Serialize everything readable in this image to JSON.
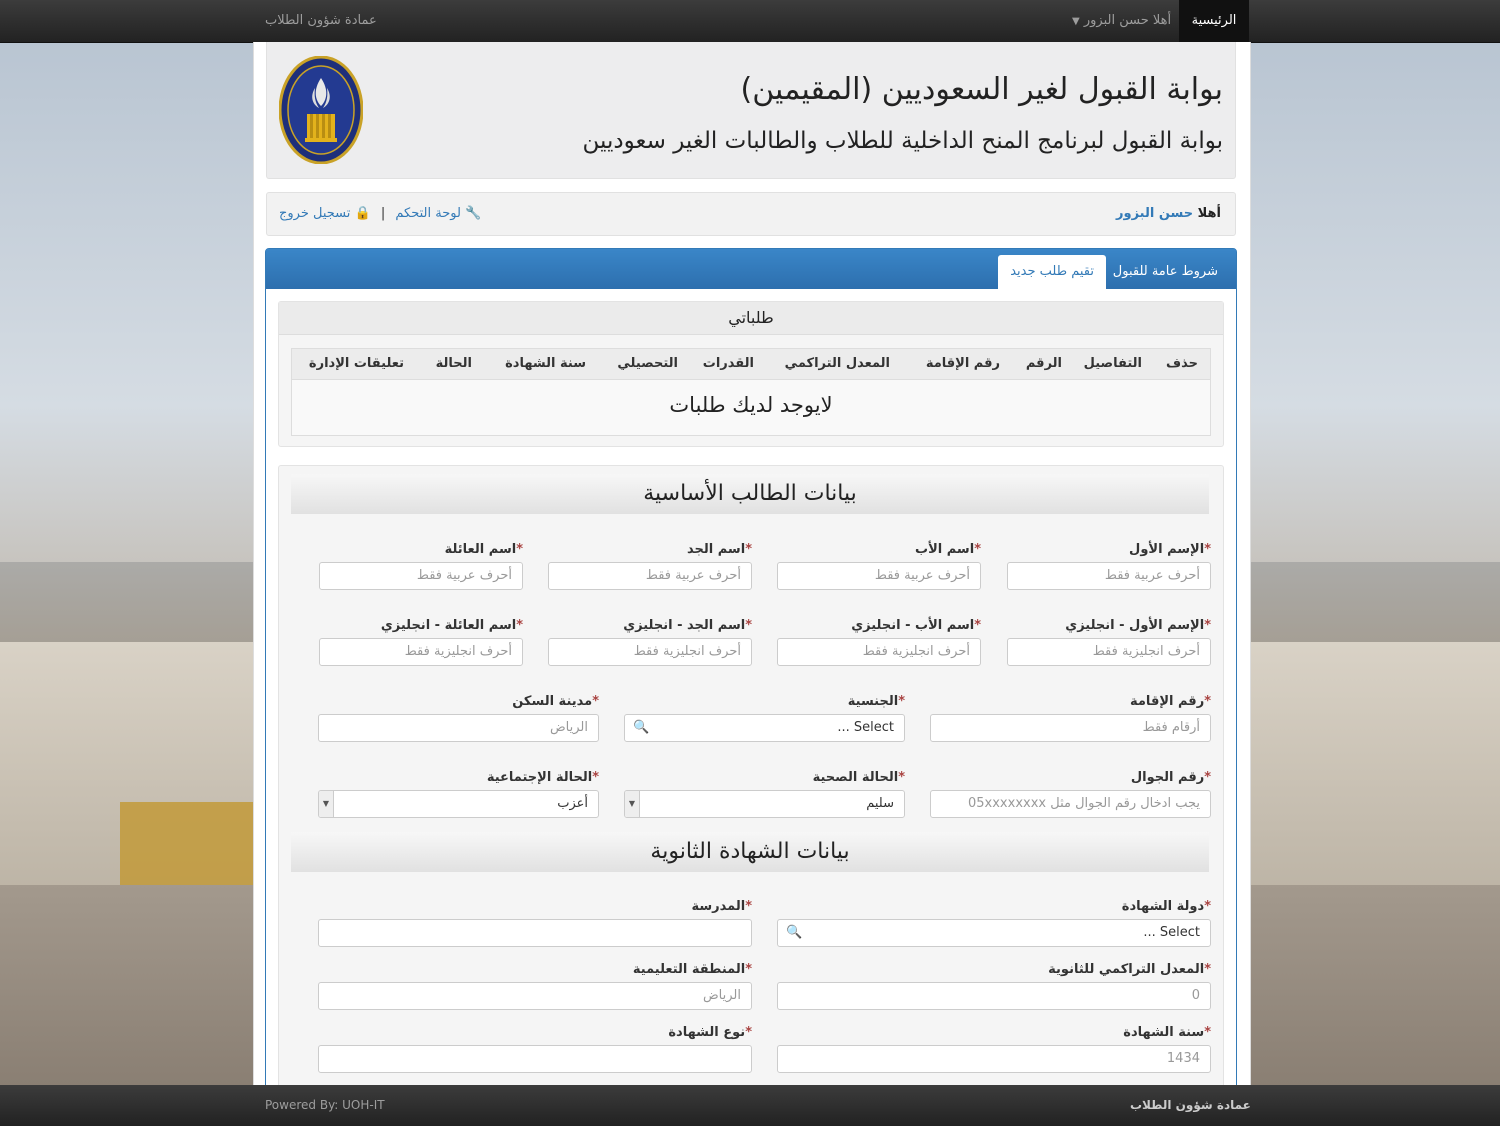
{
  "navbar": {
    "brand": "عمادة شؤون الطلاب",
    "home": "الرئيسية",
    "user_menu": "أهلا حسن البزور"
  },
  "header": {
    "title": "بوابة القبول لغير السعوديين (المقيمين)",
    "subtitle": "بوابة القبول لبرنامج المنح الداخلية للطلاب والطالبات الغير سعوديين",
    "logo_text": "University of Ha'il 2005"
  },
  "userbar": {
    "hello": "أهلا",
    "name": "حسن البزور",
    "logout": "تسجيل خروج",
    "separator": "|",
    "dashboard": "لوحة التحكم"
  },
  "tabs": [
    {
      "label": "شروط عامة للقبول",
      "active": false
    },
    {
      "label": "تقيم طلب جديد",
      "active": true
    }
  ],
  "my_requests": {
    "title": "طلباتي",
    "columns": [
      "حذف",
      "التفاصيل",
      "الرقم",
      "رقم الإقامة",
      "المعدل التراكمي",
      "القدرات",
      "التحصيلي",
      "سنة الشهادة",
      "الحالة",
      "تعليقات الإدارة"
    ],
    "empty": "لايوجد لديك طلبات"
  },
  "basic": {
    "title": "بيانات الطالب الأساسية",
    "first_name": {
      "label": "الإسم الأول",
      "placeholder": "أحرف عربية فقط"
    },
    "father_name": {
      "label": "اسم الأب",
      "placeholder": "أحرف عربية فقط"
    },
    "grand_name": {
      "label": "اسم الجد",
      "placeholder": "أحرف عربية فقط"
    },
    "family_name": {
      "label": "اسم العائلة",
      "placeholder": "أحرف عربية فقط"
    },
    "first_name_en": {
      "label": "الإسم الأول - انجليزي",
      "placeholder": "أحرف انجليزية فقط"
    },
    "father_name_en": {
      "label": "اسم الأب - انجليزي",
      "placeholder": "أحرف انجليزية فقط"
    },
    "grand_name_en": {
      "label": "اسم الجد - انجليزي",
      "placeholder": "أحرف انجليزية فقط"
    },
    "family_name_en": {
      "label": "اسم العائلة - انجليزي",
      "placeholder": "أحرف انجليزية فقط"
    },
    "iqama": {
      "label": "رقم الإقامة",
      "placeholder": "أرقام فقط"
    },
    "nationality": {
      "label": "الجنسية",
      "value": "Select ..."
    },
    "city": {
      "label": "مدينة السكن",
      "placeholder": "الرياض"
    },
    "mobile": {
      "label": "رقم الجوال",
      "placeholder": "يجب ادخال رقم الجوال مثل 05xxxxxxxx"
    },
    "health": {
      "label": "الحالة الصحية",
      "value": "سليم"
    },
    "social": {
      "label": "الحالة الإجتماعية",
      "value": "أعزب"
    }
  },
  "secondary": {
    "title": "بيانات الشهادة الثانوية",
    "country": {
      "label": "دولة الشهادة",
      "value": "Select ..."
    },
    "school": {
      "label": "المدرسة",
      "placeholder": ""
    },
    "gpa": {
      "label": "المعدل التراكمي للثانوية",
      "placeholder": "0"
    },
    "region": {
      "label": "المنطقة التعليمية",
      "placeholder": "الرياض"
    },
    "year": {
      "label": "سنة الشهادة",
      "placeholder": "1434"
    },
    "type": {
      "label": "نوع الشهادة",
      "placeholder": ""
    }
  },
  "footer": {
    "powered": "Powered By: UOH-IT",
    "dept": "عمادة شؤون الطلاب"
  },
  "colors": {
    "primary": "#337ab7",
    "required": "#a94442",
    "navbar": "#222222"
  }
}
